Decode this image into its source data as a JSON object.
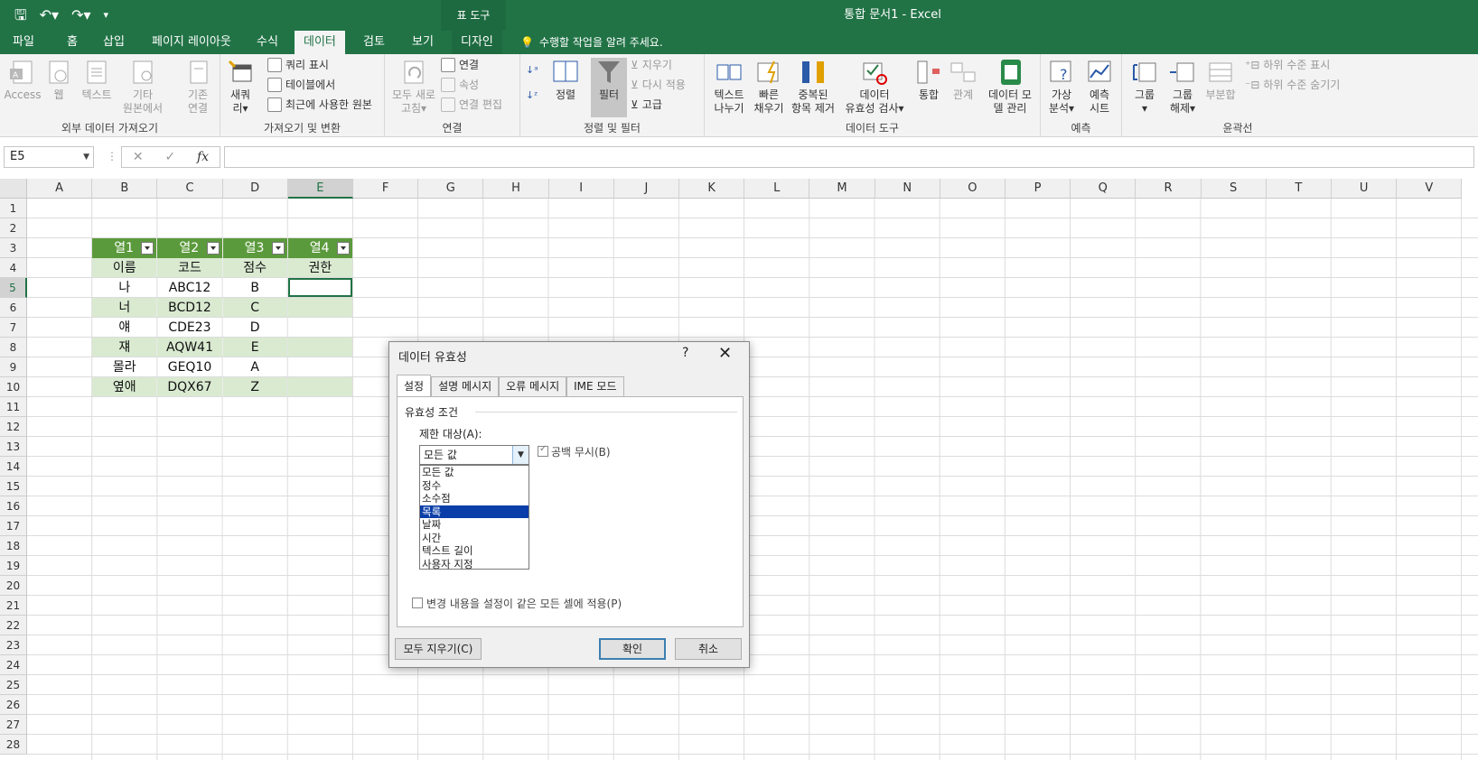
{
  "window": {
    "title": "통합 문서1 - Excel",
    "context_label": "표 도구"
  },
  "tabs": [
    {
      "label": "파일"
    },
    {
      "label": "홈"
    },
    {
      "label": "삽입"
    },
    {
      "label": "페이지 레이아웃"
    },
    {
      "label": "수식"
    },
    {
      "label": "데이터"
    },
    {
      "label": "검토"
    },
    {
      "label": "보기"
    },
    {
      "label": "디자인"
    }
  ],
  "tell_me": "수행할 작업을 알려 주세요.",
  "ribbon": {
    "ext": {
      "label": "외부 데이터 가져오기",
      "access": "Access",
      "web": "웹",
      "text": "텍스트",
      "other1": "기타",
      "other2": "원본에서"
    },
    "get": {
      "label": "가져오기 및 변환",
      "existing1": "기존",
      "existing2": "연결",
      "new1": "새쿼",
      "new2": "리",
      "show_queries": "쿼리 표시",
      "from_table": "테이블에서",
      "recent": "최근에 사용한 원본"
    },
    "conn": {
      "label": "연결",
      "refresh1": "모두 새로",
      "refresh2": "고침",
      "connections": "연결",
      "properties": "속성",
      "edit_links": "연결 편집"
    },
    "sort": {
      "label": "정렬 및 필터",
      "sort": "정렬",
      "filter": "필터",
      "clear": "지우기",
      "reapply": "다시 적용",
      "advanced": "고급"
    },
    "tools": {
      "label": "데이터 도구",
      "text_cols1": "텍스트",
      "text_cols2": "나누기",
      "flash1": "빠른",
      "flash2": "채우기",
      "dup1": "중복된",
      "dup2": "항목 제거",
      "val1": "데이터",
      "val2": "유효성 검사",
      "consol": "통합",
      "rel": "관계",
      "model1": "데이터 모",
      "model2": "델 관리"
    },
    "forecast": {
      "label": "예측",
      "whatif1": "가상",
      "whatif2": "분석",
      "sheet1": "예측",
      "sheet2": "시트"
    },
    "outline": {
      "label": "윤곽선",
      "group": "그룹",
      "ungroup1": "그룹",
      "ungroup2": "해제",
      "subtotal": "부분합",
      "show_detail": "하위 수준 표시",
      "hide_detail": "하위 수준 숨기기"
    }
  },
  "formula_bar": {
    "name_box": "E5",
    "fx": "fx",
    "cancel": "✕",
    "enter": "✓"
  },
  "columns": [
    "A",
    "B",
    "C",
    "D",
    "E",
    "F",
    "G",
    "H",
    "I",
    "J",
    "K",
    "L",
    "M",
    "N",
    "O",
    "P",
    "Q",
    "R",
    "S",
    "T",
    "U",
    "V"
  ],
  "rows": [
    "1",
    "2",
    "3",
    "4",
    "5",
    "6",
    "7",
    "8",
    "9",
    "10",
    "11",
    "12",
    "13",
    "14",
    "15",
    "16",
    "17",
    "18",
    "19",
    "20",
    "21",
    "22",
    "23",
    "24",
    "25",
    "26",
    "27",
    "28"
  ],
  "table": {
    "headers": [
      "열1",
      "열2",
      "열3",
      "열4"
    ],
    "rows": [
      [
        "이름",
        "코드",
        "점수",
        "권한"
      ],
      [
        "나",
        "ABC12",
        "B",
        ""
      ],
      [
        "너",
        "BCD12",
        "C",
        ""
      ],
      [
        "얘",
        "CDE23",
        "D",
        ""
      ],
      [
        "쟤",
        "AQW41",
        "E",
        ""
      ],
      [
        "몰라",
        "GEQ10",
        "A",
        ""
      ],
      [
        "옆애",
        "DQX67",
        "Z",
        ""
      ]
    ]
  },
  "dialog": {
    "title": "데이터 유효성",
    "help": "?",
    "close": "✕",
    "tabs": [
      "설정",
      "설명 메시지",
      "오류 메시지",
      "IME 모드"
    ],
    "section": "유효성 조건",
    "allow_label": "제한 대상(A):",
    "allow_value": "모든 값",
    "options": [
      "모든 값",
      "정수",
      "소수점",
      "목록",
      "날짜",
      "시간",
      "텍스트 길이",
      "사용자 지정"
    ],
    "selected_option": "목록",
    "ignore_blank": "공백 무시(B)",
    "apply_all": "변경 내용을 설정이 같은 모든 셀에 적용(P)",
    "clear_all": "모두 지우기(C)",
    "ok": "확인",
    "cancel": "취소"
  }
}
